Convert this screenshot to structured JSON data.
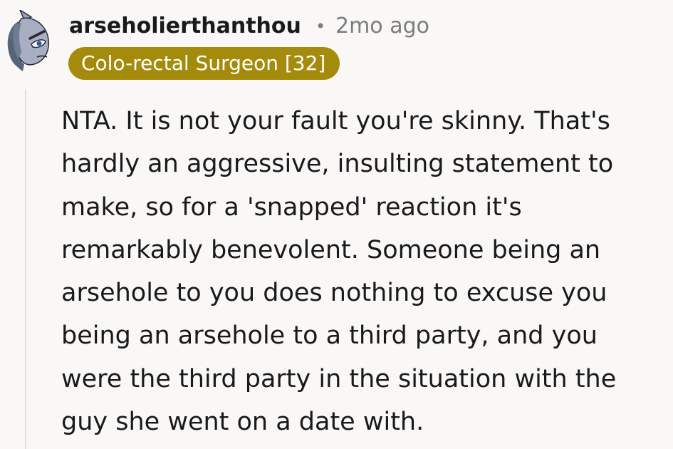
{
  "comment": {
    "author": "arseholierthanthou",
    "separator": "•",
    "timestamp": "2mo ago",
    "flair": "Colo-rectal Surgeon [32]",
    "avatar_icon": "grey-pony-avatar-icon",
    "body_lines": [
      "NTA. It is not your fault you're skinny. That's",
      "hardly an aggressive, insulting statement to",
      "make, so for a 'snapped' reaction it's",
      "remarkably benevolent. Someone being an",
      "arsehole to you does nothing to excuse you",
      "being an arsehole to a third party, and you",
      "were the third party in the situation with the",
      "guy she went on a date with."
    ]
  },
  "colors": {
    "background": "#f9f8f7",
    "flair_background": "#a48b0b",
    "flair_text": "#ffffff",
    "meta_text": "#7c7c7c",
    "thread_line": "#e3dedb"
  }
}
